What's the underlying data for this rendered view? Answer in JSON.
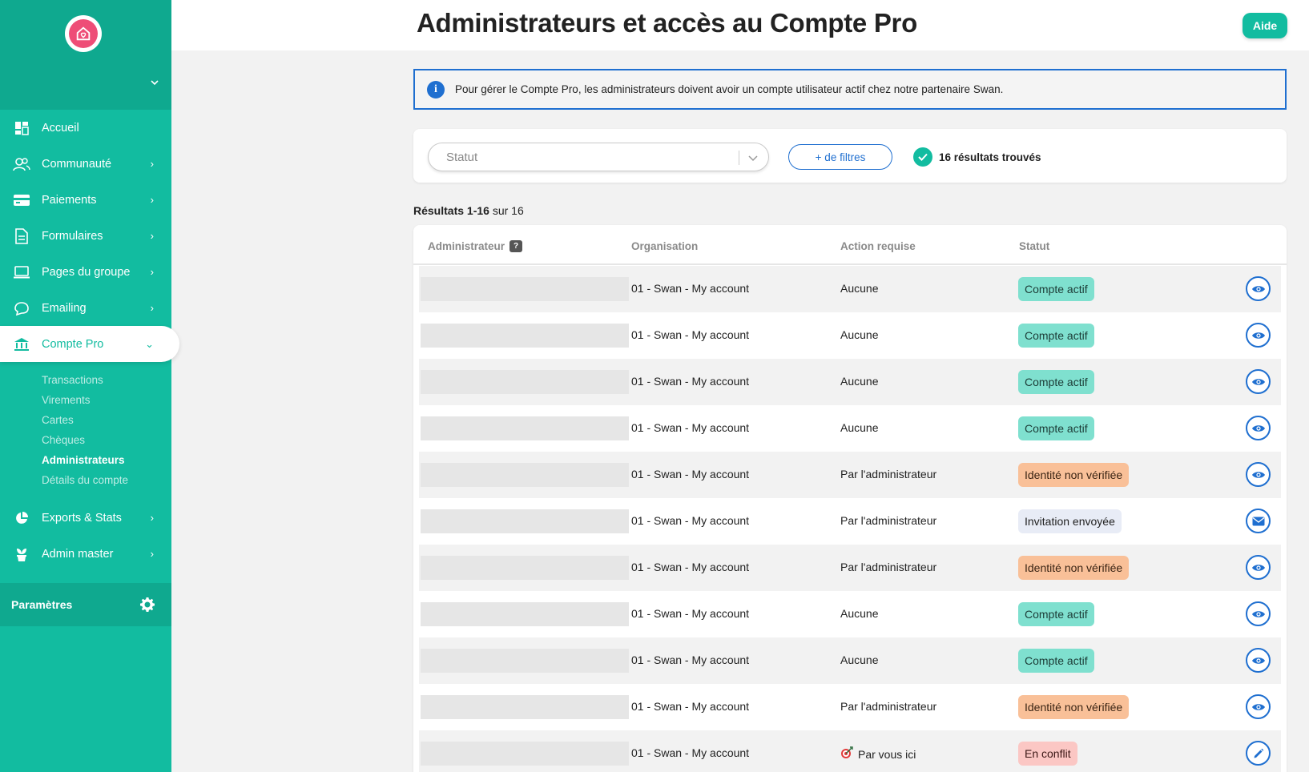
{
  "sidebar": {
    "logo_icon": "house-heart-icon",
    "nav": [
      {
        "label": "Accueil",
        "icon": "dashboard-icon",
        "has_chevron": false
      },
      {
        "label": "Communauté",
        "icon": "community-icon",
        "has_chevron": true
      },
      {
        "label": "Paiements",
        "icon": "card-icon",
        "has_chevron": true
      },
      {
        "label": "Formulaires",
        "icon": "form-icon",
        "has_chevron": true
      },
      {
        "label": "Pages du groupe",
        "icon": "laptop-icon",
        "has_chevron": true
      },
      {
        "label": "Emailing",
        "icon": "chat-icon",
        "has_chevron": true
      },
      {
        "label": "Compte Pro",
        "icon": "bank-icon",
        "has_chevron": true,
        "active": true
      }
    ],
    "subnav": [
      {
        "label": "Transactions"
      },
      {
        "label": "Virements"
      },
      {
        "label": "Cartes"
      },
      {
        "label": "Chèques"
      },
      {
        "label": "Administrateurs",
        "active": true
      },
      {
        "label": "Détails du compte"
      }
    ],
    "nav_bottom": [
      {
        "label": "Exports & Stats",
        "icon": "chart-icon",
        "has_chevron": true
      },
      {
        "label": "Admin master",
        "icon": "plant-icon",
        "has_chevron": true
      }
    ],
    "settings_label": "Paramètres"
  },
  "header": {
    "title": "Administrateurs et accès au Compte Pro",
    "help_label": "Aide"
  },
  "info_banner": {
    "text": "Pour gérer le Compte Pro, les administrateurs doivent avoir un compte utilisateur actif chez notre partenaire Swan."
  },
  "filters": {
    "status_placeholder": "Statut",
    "more_filters_label": "+ de filtres",
    "results_found": "16 résultats trouvés"
  },
  "results": {
    "range": "Résultats 1-16",
    "total": "sur 16"
  },
  "table": {
    "columns": {
      "admin": "Administrateur",
      "admin_help": "?",
      "org": "Organisation",
      "action": "Action requise",
      "status": "Statut"
    },
    "rows": [
      {
        "org": "01 - Swan - My account",
        "action": "Aucune",
        "status": "Compte actif",
        "tone": "green",
        "button": "eye"
      },
      {
        "org": "01 - Swan - My account",
        "action": "Aucune",
        "status": "Compte actif",
        "tone": "green",
        "button": "eye"
      },
      {
        "org": "01 - Swan - My account",
        "action": "Aucune",
        "status": "Compte actif",
        "tone": "green",
        "button": "eye"
      },
      {
        "org": "01 - Swan - My account",
        "action": "Aucune",
        "status": "Compte actif",
        "tone": "green",
        "button": "eye"
      },
      {
        "org": "01 - Swan - My account",
        "action": "Par l'administrateur",
        "status": "Identité non vérifiée",
        "tone": "orange",
        "button": "eye"
      },
      {
        "org": "01 - Swan - My account",
        "action": "Par l'administrateur",
        "status": "Invitation envoyée",
        "tone": "grey",
        "button": "mail"
      },
      {
        "org": "01 - Swan - My account",
        "action": "Par l'administrateur",
        "status": "Identité non vérifiée",
        "tone": "orange",
        "button": "eye"
      },
      {
        "org": "01 - Swan - My account",
        "action": "Aucune",
        "status": "Compte actif",
        "tone": "green",
        "button": "eye"
      },
      {
        "org": "01 - Swan - My account",
        "action": "Aucune",
        "status": "Compte actif",
        "tone": "green",
        "button": "eye"
      },
      {
        "org": "01 - Swan - My account",
        "action": "Par l'administrateur",
        "status": "Identité non vérifiée",
        "tone": "orange",
        "button": "eye"
      },
      {
        "org": "01 - Swan - My account",
        "action": "Par vous ici",
        "status": "En conflit",
        "tone": "red",
        "button": "edit",
        "action_icon": "target-icon"
      }
    ]
  },
  "colors": {
    "brand": "#12bca0",
    "accent": "#1f6fd0",
    "logo": "#ee4d77"
  }
}
